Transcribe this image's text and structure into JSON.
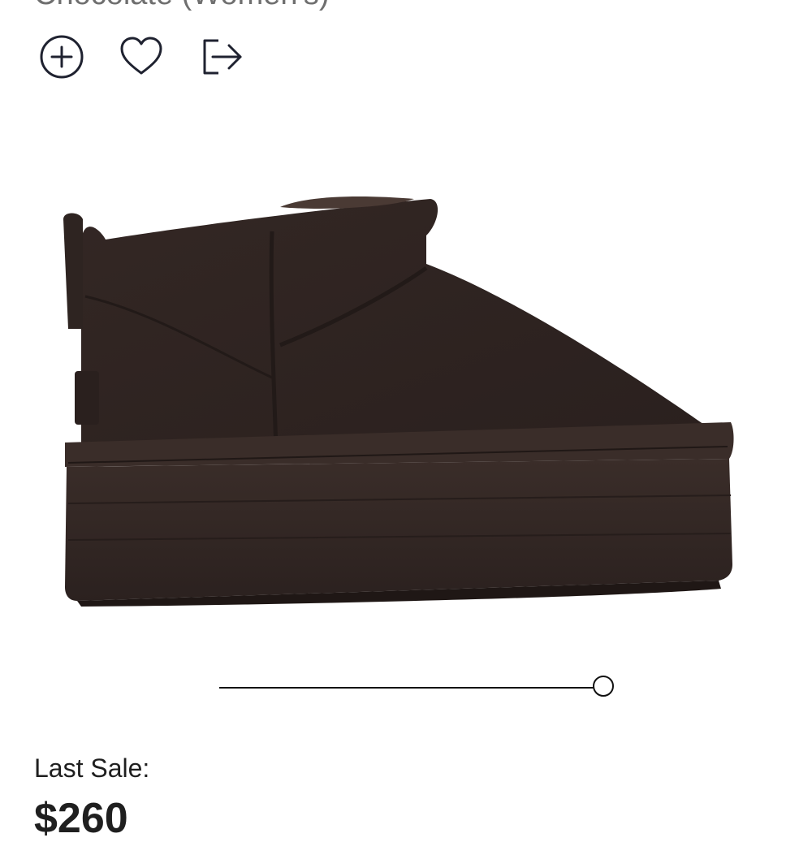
{
  "product": {
    "title_fragment": "Chocolate (Women's)",
    "image_alt": "Chocolate platform boot",
    "color_swatch": "#2f2725"
  },
  "actions": {
    "add_icon": "plus-circle-icon",
    "favorite_icon": "heart-icon",
    "share_icon": "share-arrow-icon"
  },
  "gallery": {
    "slider_position_fraction": 1.0
  },
  "sale": {
    "last_sale_label": "Last Sale:",
    "price": "$260"
  }
}
